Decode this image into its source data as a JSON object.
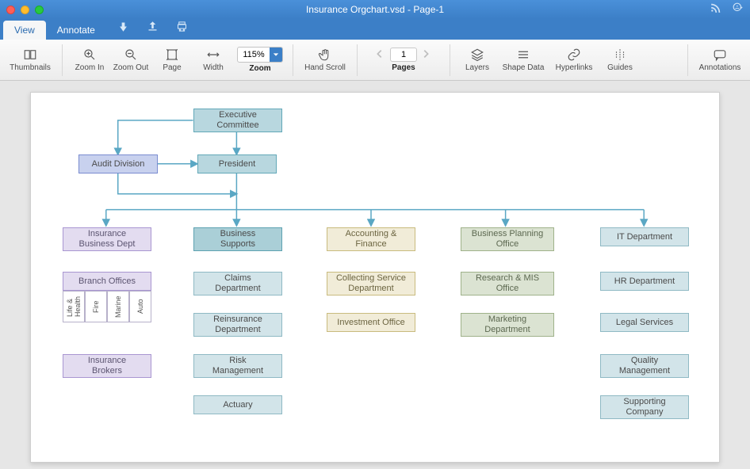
{
  "window": {
    "title": "Insurance Orgchart.vsd - Page-1"
  },
  "tabs": {
    "view": "View",
    "annotate": "Annotate"
  },
  "toolbar": {
    "thumbnails": "Thumbnails",
    "zoomIn": "Zoom In",
    "zoomOut": "Zoom Out",
    "page": "Page",
    "width": "Width",
    "zoomValue": "115%",
    "zoomLabel": "Zoom",
    "handScroll": "Hand Scroll",
    "pageNumber": "1",
    "pagesLabel": "Pages",
    "layers": "Layers",
    "shapeData": "Shape Data",
    "hyperlinks": "Hyperlinks",
    "guides": "Guides",
    "annotations": "Annotations"
  },
  "org": {
    "executiveCommittee": "Executive\nCommittee",
    "auditDivision": "Audit Division",
    "president": "President",
    "insuranceBusinessDept": "Insurance\nBusiness Dept",
    "businessSupports": "Business\nSupports",
    "accountingFinance": "Accounting &\nFinance",
    "businessPlanningOffice": "Business Planning\nOffice",
    "itDepartment": "IT Department",
    "branchOffices": "Branch Offices",
    "branchSub": {
      "lifeHealth": "Life &\nHealth",
      "fire": "Fire",
      "marine": "Marine",
      "auto": "Auto"
    },
    "claimsDepartment": "Claims\nDepartment",
    "collectingService": "Collecting Service\nDepartment",
    "researchMis": "Research & MIS\nOffice",
    "hrDepartment": "HR Department",
    "reinsurance": "Reinsurance\nDepartment",
    "investmentOffice": "Investment Office",
    "marketingDepartment": "Marketing\nDepartment",
    "legalServices": "Legal Services",
    "insuranceBrokers": "Insurance\nBrokers",
    "riskManagement": "Risk\nManagement",
    "qualityManagement": "Quality\nManagement",
    "actuary": "Actuary",
    "supportingCompany": "Supporting\nCompany"
  },
  "chart_data": {
    "type": "diagram",
    "layout": "org-chart",
    "nodes": [
      {
        "id": "exec",
        "label": "Executive Committee",
        "style": "teal"
      },
      {
        "id": "audit",
        "label": "Audit Division",
        "style": "blue"
      },
      {
        "id": "president",
        "label": "President",
        "style": "teal"
      },
      {
        "id": "insBiz",
        "label": "Insurance Business Dept",
        "style": "purple"
      },
      {
        "id": "bizSup",
        "label": "Business Supports",
        "style": "dkteal"
      },
      {
        "id": "acct",
        "label": "Accounting & Finance",
        "style": "tan"
      },
      {
        "id": "bizPlan",
        "label": "Business Planning Office",
        "style": "sage"
      },
      {
        "id": "it",
        "label": "IT Department",
        "style": "ltteal"
      },
      {
        "id": "branch",
        "label": "Branch Offices",
        "style": "purple",
        "children": [
          {
            "id": "lifeHealth",
            "label": "Life & Health"
          },
          {
            "id": "fire",
            "label": "Fire"
          },
          {
            "id": "marine",
            "label": "Marine"
          },
          {
            "id": "auto",
            "label": "Auto"
          }
        ]
      },
      {
        "id": "claims",
        "label": "Claims Department",
        "style": "ltteal"
      },
      {
        "id": "collect",
        "label": "Collecting Service Department",
        "style": "tan"
      },
      {
        "id": "research",
        "label": "Research & MIS Office",
        "style": "sage"
      },
      {
        "id": "hr",
        "label": "HR Department",
        "style": "ltteal"
      },
      {
        "id": "reins",
        "label": "Reinsurance Department",
        "style": "ltteal"
      },
      {
        "id": "invest",
        "label": "Investment Office",
        "style": "tan"
      },
      {
        "id": "mkt",
        "label": "Marketing Department",
        "style": "sage"
      },
      {
        "id": "legal",
        "label": "Legal Services",
        "style": "ltteal"
      },
      {
        "id": "brokers",
        "label": "Insurance Brokers",
        "style": "purple"
      },
      {
        "id": "risk",
        "label": "Risk Management",
        "style": "ltteal"
      },
      {
        "id": "quality",
        "label": "Quality Management",
        "style": "ltteal"
      },
      {
        "id": "actuary",
        "label": "Actuary",
        "style": "ltteal"
      },
      {
        "id": "supportCo",
        "label": "Supporting Company",
        "style": "ltteal"
      }
    ],
    "edges": [
      {
        "from": "exec",
        "to": "audit"
      },
      {
        "from": "exec",
        "to": "president"
      },
      {
        "from": "audit",
        "to": "president"
      },
      {
        "from": "president",
        "to": "insBiz"
      },
      {
        "from": "president",
        "to": "bizSup"
      },
      {
        "from": "president",
        "to": "acct"
      },
      {
        "from": "president",
        "to": "bizPlan"
      },
      {
        "from": "president",
        "to": "it"
      },
      {
        "from": "insBiz",
        "to": "branch"
      },
      {
        "from": "insBiz",
        "to": "brokers"
      },
      {
        "from": "bizSup",
        "to": "claims"
      },
      {
        "from": "bizSup",
        "to": "reins"
      },
      {
        "from": "bizSup",
        "to": "risk"
      },
      {
        "from": "bizSup",
        "to": "actuary"
      },
      {
        "from": "acct",
        "to": "collect"
      },
      {
        "from": "acct",
        "to": "invest"
      },
      {
        "from": "bizPlan",
        "to": "research"
      },
      {
        "from": "bizPlan",
        "to": "mkt"
      },
      {
        "from": "it",
        "to": "hr"
      },
      {
        "from": "it",
        "to": "legal"
      },
      {
        "from": "it",
        "to": "quality"
      },
      {
        "from": "it",
        "to": "supportCo"
      }
    ]
  }
}
